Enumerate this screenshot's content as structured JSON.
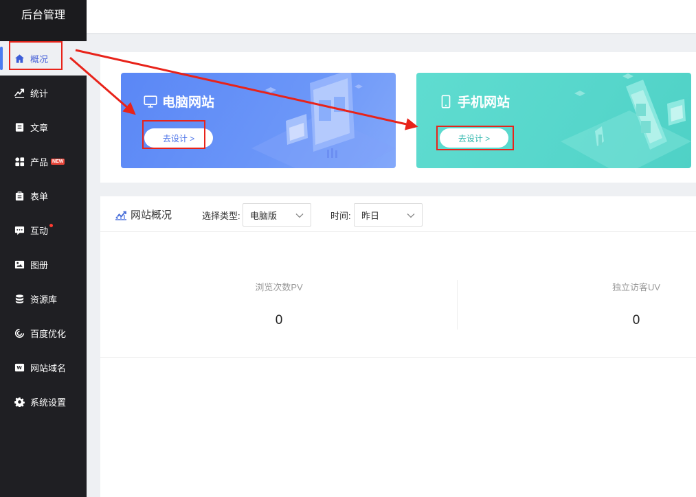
{
  "sidebar": {
    "brand": "后台管理",
    "items": [
      {
        "label": "概况",
        "icon": "home-icon",
        "active": true
      },
      {
        "label": "统计",
        "icon": "trend-icon"
      },
      {
        "label": "文章",
        "icon": "article-icon"
      },
      {
        "label": "产品",
        "icon": "grid-icon",
        "badge": "NEW"
      },
      {
        "label": "表单",
        "icon": "clipboard-icon"
      },
      {
        "label": "互动",
        "icon": "chat-icon",
        "dot": true
      },
      {
        "label": "图册",
        "icon": "album-icon"
      },
      {
        "label": "资源库",
        "icon": "database-icon"
      },
      {
        "label": "百度优化",
        "icon": "spiral-icon"
      },
      {
        "label": "网站域名",
        "icon": "w-icon"
      },
      {
        "label": "系统设置",
        "icon": "gear-icon"
      }
    ]
  },
  "design": {
    "pc": {
      "title": "电脑网站",
      "button": "去设计 >",
      "icon": "monitor-icon"
    },
    "mobile": {
      "title": "手机网站",
      "button": "去设计 >",
      "icon": "phone-icon"
    }
  },
  "overview": {
    "title": "网站概况",
    "icon": "chart-line-icon",
    "type_label": "选择类型:",
    "type_value": "电脑版",
    "time_label": "时间:",
    "time_value": "昨日",
    "metrics": [
      {
        "label": "浏览次数PV",
        "value": "0"
      },
      {
        "label": "独立访客UV",
        "value": "0"
      }
    ]
  },
  "colors": {
    "sidebar_bg": "#1f1f23",
    "accent": "#4a7cf0",
    "pc_card": "#6b96f8",
    "mobile_card": "#56d6cb",
    "annotation": "#e8231a"
  }
}
